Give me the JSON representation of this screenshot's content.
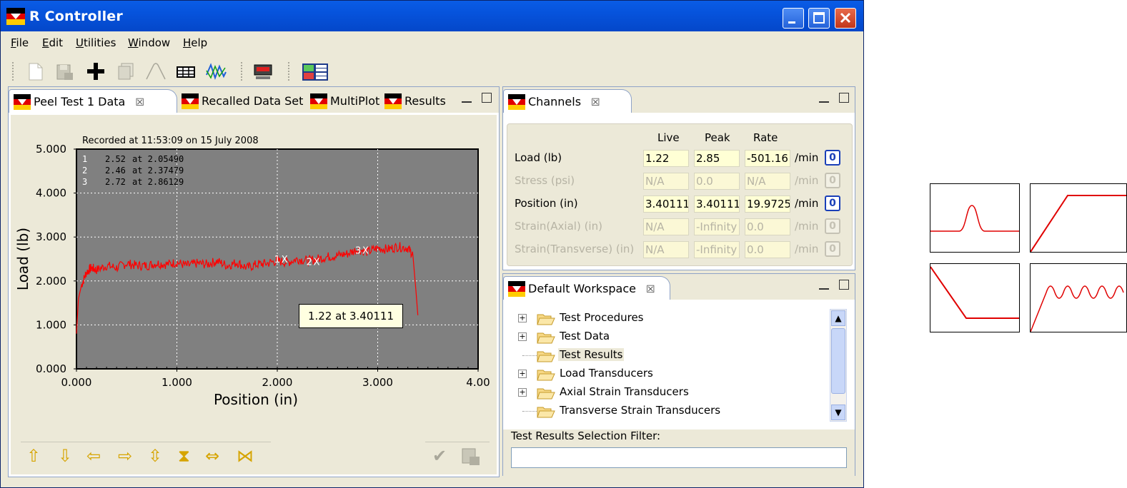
{
  "window": {
    "title": "R Controller"
  },
  "menu": [
    "File",
    "Edit",
    "Utilities",
    "Window",
    "Help"
  ],
  "toolbar": {
    "icons": [
      "new-doc-icon",
      "save-icon",
      "plus-icon",
      "copy-icon",
      "peak-icon",
      "table-icon",
      "waveform-icon",
      "display-icon",
      "tiles-icon"
    ]
  },
  "left_pane": {
    "tabs": [
      {
        "label": "Peel Test 1 Data",
        "close": "☒"
      },
      {
        "label": "Recalled Data Set"
      },
      {
        "label": "MultiPlot"
      },
      {
        "label": "Results"
      }
    ]
  },
  "chart_data": {
    "type": "line",
    "title": "Recorded at 11:53:09 on 15 July 2008",
    "xlabel": "Position (in)",
    "ylabel": "Load (lb)",
    "xlim": [
      0,
      4
    ],
    "ylim": [
      0,
      5
    ],
    "xticks": [
      "0.000",
      "1.000",
      "2.000",
      "3.000",
      "4.00"
    ],
    "yticks": [
      "0.000",
      "1.000",
      "2.000",
      "3.000",
      "4.000",
      "5.000"
    ],
    "grid": true,
    "series": [
      {
        "x": [
          0.0,
          0.02,
          0.05,
          0.1,
          0.15,
          0.2,
          0.3,
          0.4,
          0.5,
          0.6,
          0.7,
          0.8,
          0.9,
          1.0,
          1.1,
          1.2,
          1.3,
          1.4,
          1.5,
          1.6,
          1.7,
          1.8,
          1.9,
          2.0,
          2.1,
          2.2,
          2.3,
          2.4,
          2.5,
          2.6,
          2.7,
          2.8,
          2.9,
          3.0,
          3.1,
          3.2,
          3.3,
          3.35,
          3.38,
          3.4
        ],
        "y": [
          0.8,
          1.6,
          1.9,
          2.2,
          2.3,
          2.25,
          2.35,
          2.3,
          2.4,
          2.35,
          2.35,
          2.4,
          2.38,
          2.42,
          2.35,
          2.4,
          2.38,
          2.45,
          2.35,
          2.42,
          2.3,
          2.38,
          2.4,
          2.46,
          2.42,
          2.5,
          2.46,
          2.5,
          2.55,
          2.58,
          2.62,
          2.72,
          2.66,
          2.75,
          2.72,
          2.78,
          2.75,
          2.6,
          1.8,
          1.22
        ]
      }
    ],
    "markers": [
      {
        "label": "1",
        "x": 2.0549,
        "y": 2.52,
        "text": "2.52",
        "at": "at 2.05490"
      },
      {
        "label": "2",
        "x": 2.37479,
        "y": 2.46,
        "text": "2.46",
        "at": "at 2.37479"
      },
      {
        "label": "3",
        "x": 2.86129,
        "y": 2.72,
        "text": "2.72",
        "at": "at 2.86129"
      }
    ],
    "marker_suffix": "X",
    "tooltip": "1.22  at 3.40111",
    "plot_bg": "#808080",
    "line_color": "#ff0000"
  },
  "nav_buttons": [
    "up-arrow-icon",
    "down-arrow-icon",
    "left-arrow-icon",
    "right-arrow-icon",
    "expand-vertical-icon",
    "contract-vertical-icon",
    "expand-horizontal-icon",
    "contract-horizontal-icon"
  ],
  "channels_pane": {
    "tab": "Channels",
    "headers": [
      "Live",
      "Peak",
      "Rate"
    ],
    "rows": [
      {
        "name": "Load (lb)",
        "live": "1.22",
        "peak": "2.85",
        "rate": "-501.16",
        "unit": "/min",
        "zero": "0",
        "enabled": true
      },
      {
        "name": "Stress (psi)",
        "live": "N/A",
        "peak": "0.0",
        "rate": "N/A",
        "unit": "/min",
        "zero": "0",
        "enabled": false
      },
      {
        "name": "Position (in)",
        "live": "3.40111",
        "peak": "3.40111",
        "rate": "19.9725",
        "unit": "/min",
        "zero": "0",
        "enabled": true
      },
      {
        "name": "Strain(Axial) (in)",
        "live": "N/A",
        "peak": "-Infinity",
        "rate": "0.0",
        "unit": "/min",
        "zero": "0",
        "enabled": false
      },
      {
        "name": "Strain(Transverse) (in)",
        "live": "N/A",
        "peak": "-Infinity",
        "rate": "0.0",
        "unit": "/min",
        "zero": "0",
        "enabled": false
      }
    ]
  },
  "workspace_pane": {
    "tab": "Default Workspace",
    "tree": [
      {
        "label": "Test Procedures",
        "expandable": true
      },
      {
        "label": "Test Data",
        "expandable": true
      },
      {
        "label": "Test Results",
        "expandable": false,
        "selected": true
      },
      {
        "label": "Load Transducers",
        "expandable": true
      },
      {
        "label": "Axial Strain Transducers",
        "expandable": true
      },
      {
        "label": "Transverse Strain Transducers",
        "expandable": false
      }
    ],
    "filter_label": "Test Results Selection Filter:",
    "filter_value": ""
  },
  "thumbnails": [
    "pulse-waveform",
    "ramp-up-hold",
    "ramp-down-hold",
    "ramp-then-oscillation"
  ],
  "colors": {
    "titlebar": "#0653dc",
    "accent": "#ff0000",
    "panel": "#ece9d8"
  }
}
